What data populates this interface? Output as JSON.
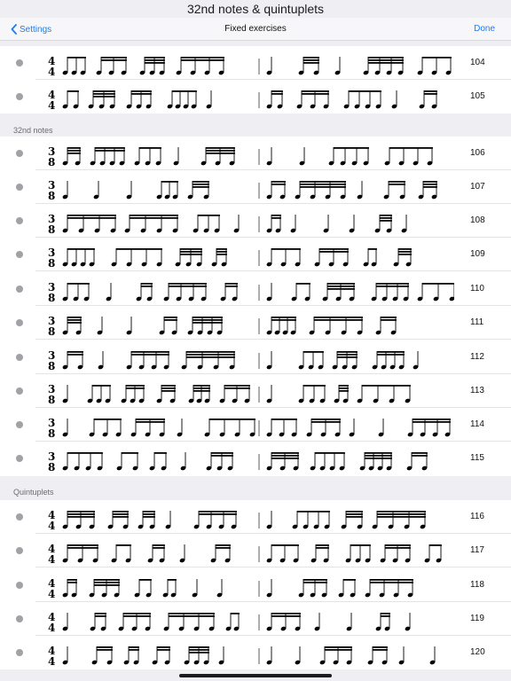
{
  "window": {
    "title": "32nd notes & quintuplets"
  },
  "nav": {
    "back_label": "Settings",
    "title": "Fixed exercises",
    "done_label": "Done"
  },
  "sections": [
    {
      "header": "",
      "rows": [
        {
          "number": "104",
          "time": [
            "4",
            "4"
          ]
        },
        {
          "number": "105",
          "time": [
            "4",
            "4"
          ]
        }
      ]
    },
    {
      "header": "32nd notes",
      "rows": [
        {
          "number": "106",
          "time": [
            "3",
            "8"
          ]
        },
        {
          "number": "107",
          "time": [
            "3",
            "8"
          ]
        },
        {
          "number": "108",
          "time": [
            "3",
            "8"
          ]
        },
        {
          "number": "109",
          "time": [
            "3",
            "8"
          ]
        },
        {
          "number": "110",
          "time": [
            "3",
            "8"
          ]
        },
        {
          "number": "111",
          "time": [
            "3",
            "8"
          ]
        },
        {
          "number": "112",
          "time": [
            "3",
            "8"
          ]
        },
        {
          "number": "113",
          "time": [
            "3",
            "8"
          ]
        },
        {
          "number": "114",
          "time": [
            "3",
            "8"
          ]
        },
        {
          "number": "115",
          "time": [
            "3",
            "8"
          ]
        }
      ]
    },
    {
      "header": "Quintuplets",
      "rows": [
        {
          "number": "116",
          "time": [
            "4",
            "4"
          ]
        },
        {
          "number": "117",
          "time": [
            "4",
            "4"
          ]
        },
        {
          "number": "118",
          "time": [
            "4",
            "4"
          ]
        },
        {
          "number": "119",
          "time": [
            "4",
            "4"
          ]
        },
        {
          "number": "120",
          "time": [
            "4",
            "4"
          ]
        }
      ]
    }
  ],
  "colors": {
    "accent": "#1e7cf2",
    "bullet": "#a1a1a6",
    "background": "#eeeef3"
  },
  "icons": {
    "back": "chevron-left-icon",
    "bullet": "bullet-dot-icon"
  }
}
